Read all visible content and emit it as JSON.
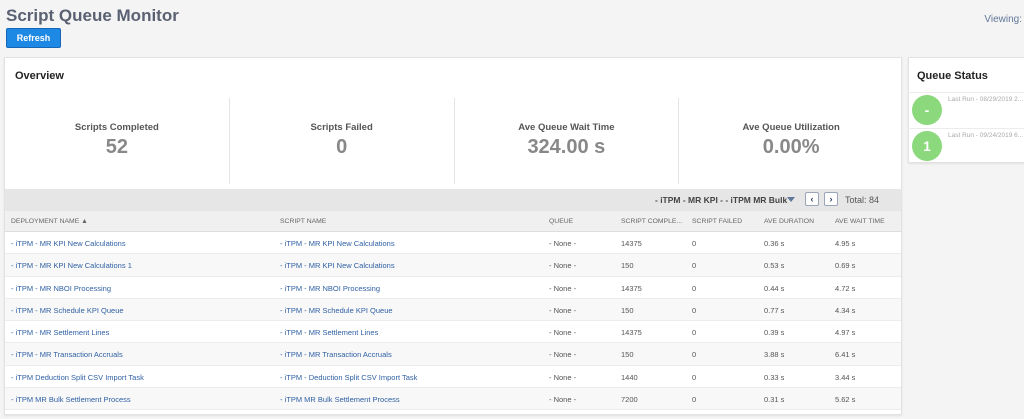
{
  "page": {
    "title": "Script Queue Monitor",
    "viewing_label": "Viewing:",
    "refresh_label": "Refresh"
  },
  "overview": {
    "title": "Overview",
    "stats": [
      {
        "label": "Scripts Completed",
        "value": "52"
      },
      {
        "label": "Scripts Failed",
        "value": "0"
      },
      {
        "label": "Ave Queue Wait Time",
        "value": "324.00 s"
      },
      {
        "label": "Ave Queue Utilization",
        "value": "0.00%"
      }
    ],
    "toolbar": {
      "deployment_filter": "- iTPM - MR KPI - - iTPM MR Bulk",
      "prev": "‹",
      "next": "›",
      "total": "Total: 84"
    },
    "columns": [
      "DEPLOYMENT NAME ▲",
      "SCRIPT NAME",
      "QUEUE",
      "SCRIPT COMPLE...",
      "SCRIPT FAILED",
      "AVE DURATION",
      "AVE WAIT TIME"
    ],
    "rows": [
      [
        "- iTPM - MR KPI New Calculations",
        "- iTPM - MR KPI New Calculations",
        "- None -",
        "14375",
        "0",
        "0.36 s",
        "4.95 s"
      ],
      [
        "- iTPM - MR KPI New Calculations 1",
        "- iTPM - MR KPI New Calculations",
        "- None -",
        "150",
        "0",
        "0.53 s",
        "0.69 s"
      ],
      [
        "- iTPM - MR NBOI Processing",
        "- iTPM - MR NBOI Processing",
        "- None -",
        "14375",
        "0",
        "0.44 s",
        "4.72 s"
      ],
      [
        "- iTPM - MR Schedule KPI Queue",
        "- iTPM - MR Schedule KPI Queue",
        "- None -",
        "150",
        "0",
        "0.77 s",
        "4.34 s"
      ],
      [
        "- iTPM - MR Settlement Lines",
        "- iTPM - MR Settlement Lines",
        "- None -",
        "14375",
        "0",
        "0.39 s",
        "4.97 s"
      ],
      [
        "- iTPM - MR Transaction Accruals",
        "- iTPM - MR Transaction Accruals",
        "- None -",
        "150",
        "0",
        "3.88 s",
        "6.41 s"
      ],
      [
        "- iTPM Deduction Split CSV Import Task",
        "- iTPM - Deduction Split CSV Import Task",
        "- None -",
        "1440",
        "0",
        "0.33 s",
        "3.44 s"
      ],
      [
        "- iTPM MR Bulk Settlement Process",
        "- iTPM MR Bulk Settlement Process",
        "- None -",
        "7200",
        "0",
        "0.31 s",
        "5.62 s"
      ]
    ]
  },
  "queue_status": {
    "title": "Queue Status",
    "items": [
      {
        "badge": "-",
        "last_run": "Last Run - 08/29/2019 2..."
      },
      {
        "badge": "1",
        "last_run": "Last Run - 09/24/2019 6..."
      }
    ]
  }
}
